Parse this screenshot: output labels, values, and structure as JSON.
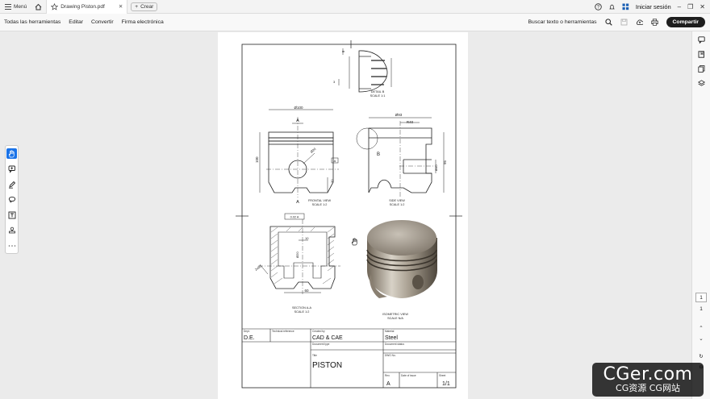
{
  "tabbar": {
    "menu_label": "Menú",
    "tab_title": "Drawing Piston.pdf",
    "new_tab_label": "Crear",
    "signin_label": "Iniciar sesión"
  },
  "toolbar": {
    "items": [
      "Todas las herramientas",
      "Editar",
      "Convertir",
      "Firma electrónica"
    ],
    "search_label": "Buscar texto o herramientas",
    "share_label": "Compartir"
  },
  "page_nav": {
    "page_indicator": "1",
    "current_page": "1"
  },
  "drawing": {
    "detail_label": "DETAIL B",
    "detail_scale": "SCALE 1:1",
    "front_label": "FRONTAL VIEW",
    "front_scale": "SCALE 1:2",
    "side_label": "SIDE VIEW",
    "side_scale": "SCALE 1:2",
    "section_label": "SECTION A-A",
    "section_scale": "SCALE 1:2",
    "iso_label": "ISOMETRIC VIEW",
    "iso_scale": "SCALE N/A",
    "dim_d100": "Ø100",
    "dim_100": "100",
    "dim_d93": "Ø93",
    "dim_r40": "R40",
    "dim_95": "95",
    "dim_d40": "Ø40",
    "dim_30": "30",
    "dim_d20": "Ø20",
    "dim_60": "60",
    "dim_10": "10",
    "dim_2x60": "2x60",
    "dim_3": "3",
    "dim_m": "m",
    "cut_a": "A",
    "cut_b": "B",
    "tolerance": "0.02 A",
    "datum": "A"
  },
  "titleblock": {
    "dept_label": "Dept.",
    "dept_value": "D.E.",
    "techref_label": "Technical reference",
    "createdby_label": "Created by",
    "createdby_value": "CAD & CAE",
    "material_label": "Material",
    "material_value": "Steel",
    "doctype_label": "Document type",
    "docstatus_label": "Document status",
    "title_label": "Title",
    "title_value": "PISTON",
    "dwgno_label": "DWG No.",
    "rev_label": "Rev.",
    "rev_value": "A",
    "dateofissue_label": "Date of issue",
    "sheet_label": "Sheet",
    "sheet_value": "1/1"
  },
  "watermark": {
    "main": "CGer.com",
    "sub": "CG资源 CG网站"
  }
}
